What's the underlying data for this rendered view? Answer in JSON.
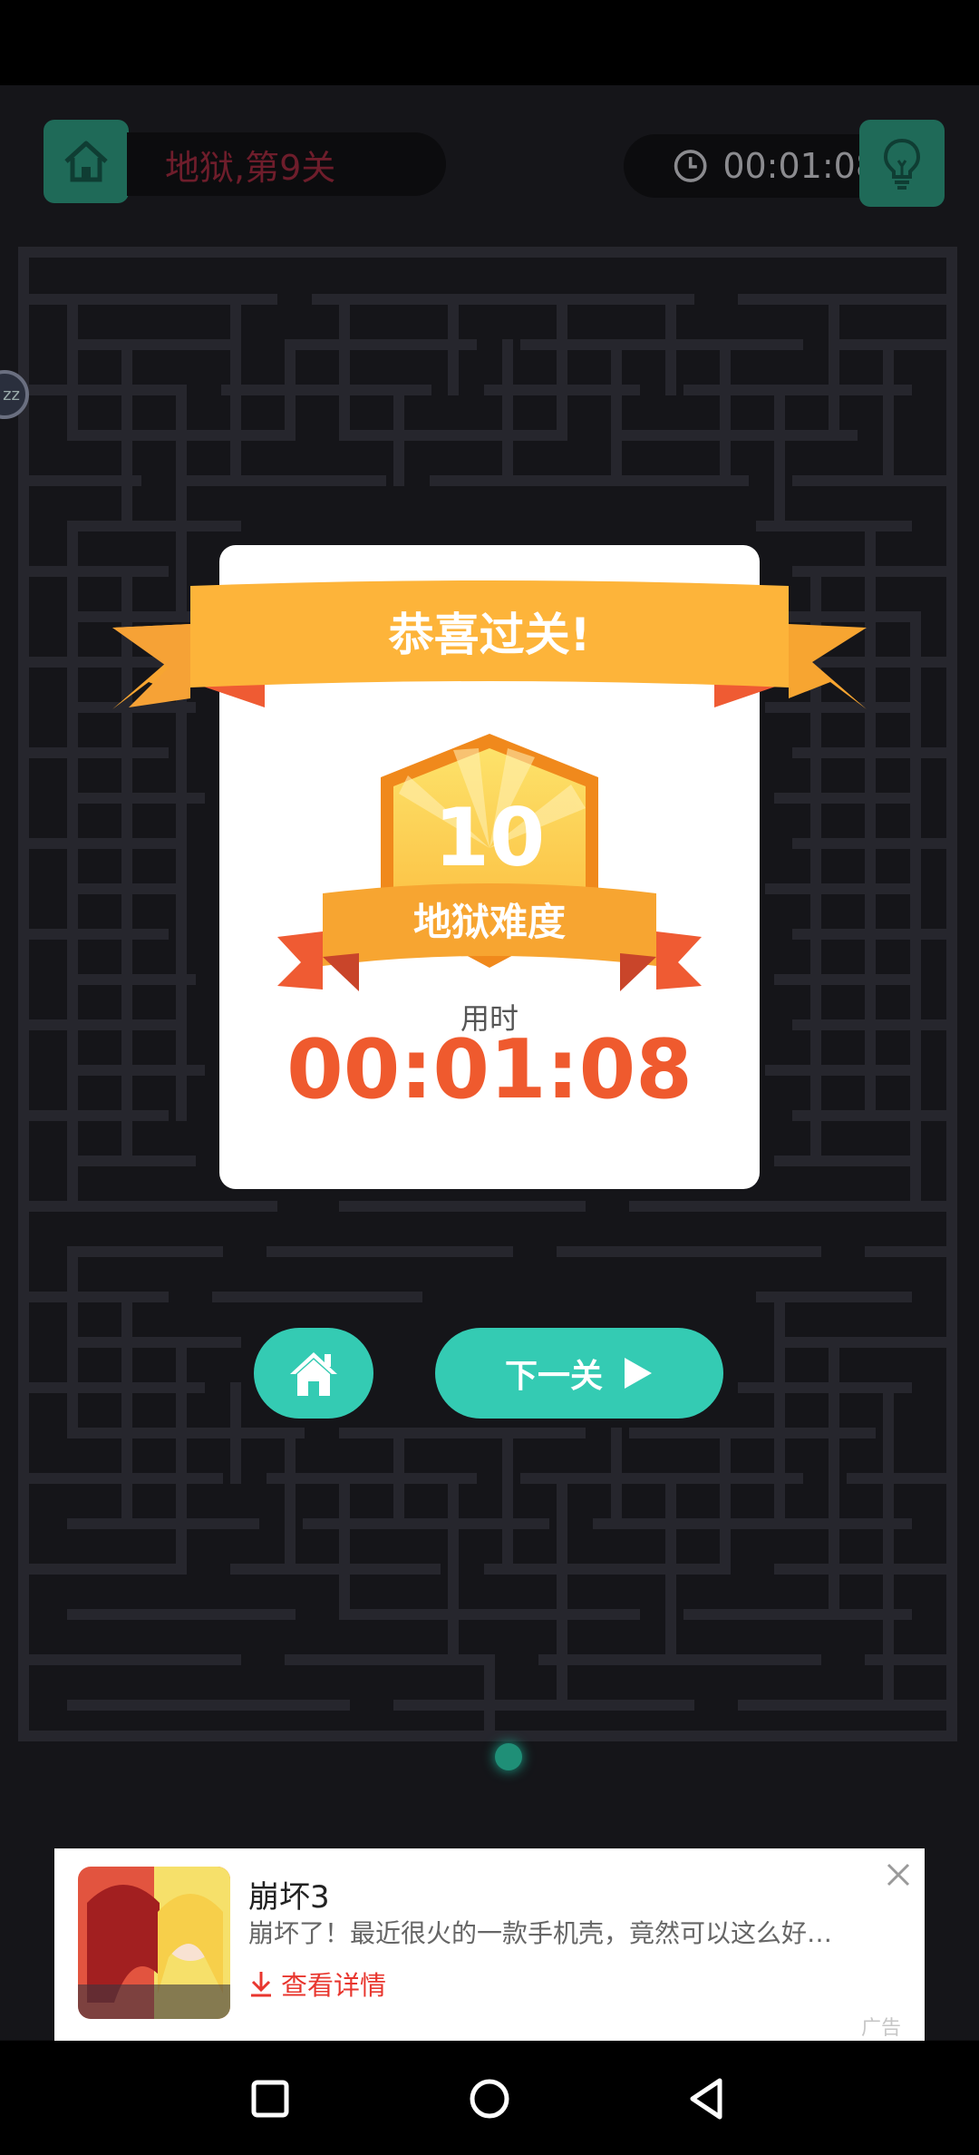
{
  "header": {
    "level_text": "地狱,第9关",
    "timer_text": "00:01:08"
  },
  "bubble_text": "zz",
  "result": {
    "title": "恭喜过关!",
    "badge_number": "10",
    "badge_label": "地狱难度",
    "time_label": "用时",
    "time_value": "00:01:08"
  },
  "actions": {
    "next_label": "下一关"
  },
  "ad": {
    "title": "崩坏3",
    "description": "崩坏了！最近很火的一款手机壳，竟然可以这么好…",
    "cta_label": "查看详情",
    "tag": "广告"
  },
  "colors": {
    "accent_green": "#34cbb3",
    "ribbon_orange": "#f7a531",
    "time_red": "#ef5a2e"
  }
}
